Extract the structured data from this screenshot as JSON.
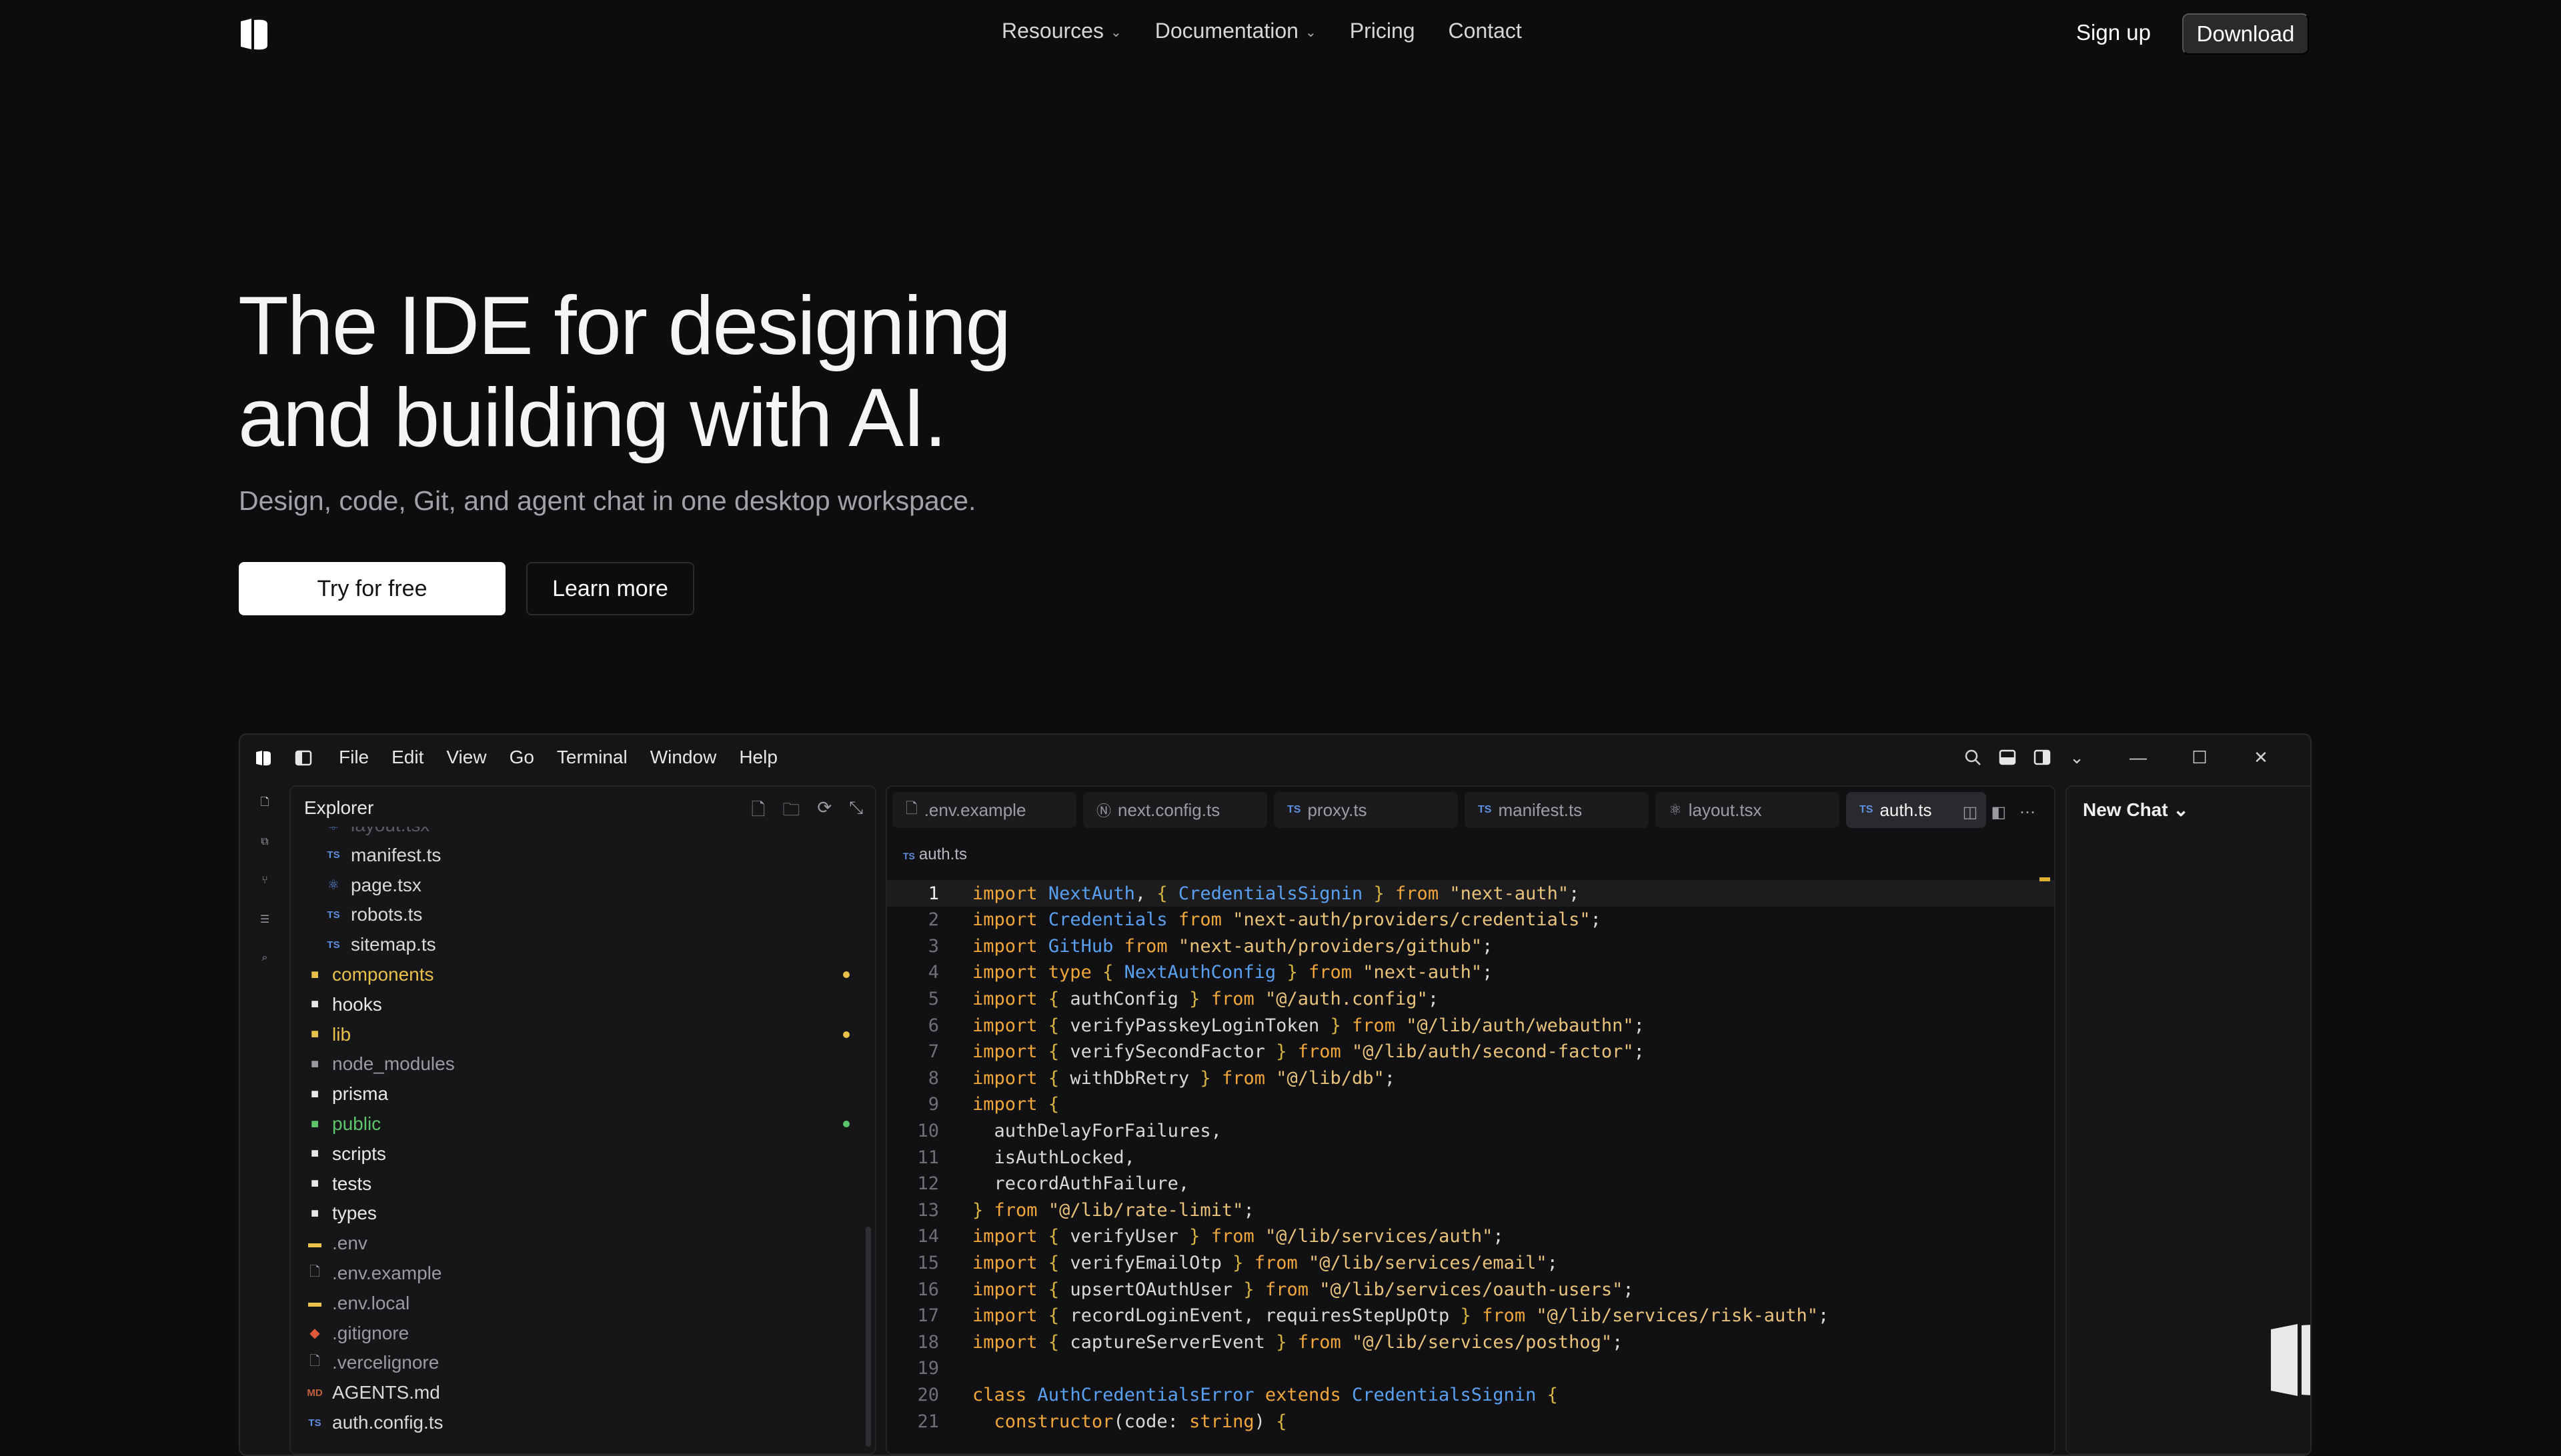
{
  "nav": {
    "items": [
      {
        "label": "Resources",
        "dropdown": true
      },
      {
        "label": "Documentation",
        "dropdown": true
      },
      {
        "label": "Pricing",
        "dropdown": false
      },
      {
        "label": "Contact",
        "dropdown": false
      }
    ],
    "signup": "Sign up",
    "download": "Download"
  },
  "hero": {
    "title_line1": "The IDE for designing",
    "title_line2": "and building with AI.",
    "subtitle": "Design, code, Git, and agent chat in one desktop workspace.",
    "primary_cta": "Try for free",
    "secondary_cta": "Learn more"
  },
  "ide": {
    "menu": [
      "File",
      "Edit",
      "View",
      "Go",
      "Terminal",
      "Window",
      "Help"
    ],
    "explorer": {
      "title": "Explorer",
      "items": [
        {
          "name": "layout.tsx",
          "icon": "react-icon",
          "color": "#5a5a60",
          "indent": 1
        },
        {
          "name": "manifest.ts",
          "icon": "ts-icon",
          "color": "#d9d9d9",
          "indent": 1
        },
        {
          "name": "page.tsx",
          "icon": "react-icon",
          "color": "#d9d9d9",
          "indent": 1
        },
        {
          "name": "robots.ts",
          "icon": "ts-icon",
          "color": "#d9d9d9",
          "indent": 1
        },
        {
          "name": "sitemap.ts",
          "icon": "ts-icon",
          "color": "#d9d9d9",
          "indent": 1
        },
        {
          "name": "components",
          "icon": "folder-icon",
          "color": "#e8c04a",
          "indent": 0,
          "dot": "#e8c04a"
        },
        {
          "name": "hooks",
          "icon": "folder-icon",
          "color": "#e8e8e8",
          "indent": 0
        },
        {
          "name": "lib",
          "icon": "folder-icon",
          "color": "#e8c04a",
          "indent": 0,
          "dot": "#e8c04a"
        },
        {
          "name": "node_modules",
          "icon": "folder-icon",
          "color": "#9a9aa0",
          "indent": 0
        },
        {
          "name": "prisma",
          "icon": "folder-icon",
          "color": "#e8e8e8",
          "indent": 0
        },
        {
          "name": "public",
          "icon": "folder-icon",
          "color": "#5cc46a",
          "indent": 0,
          "dot": "#5cc46a"
        },
        {
          "name": "scripts",
          "icon": "folder-icon",
          "color": "#e8e8e8",
          "indent": 0
        },
        {
          "name": "tests",
          "icon": "folder-icon",
          "color": "#e8e8e8",
          "indent": 0
        },
        {
          "name": "types",
          "icon": "folder-icon",
          "color": "#e8e8e8",
          "indent": 0
        },
        {
          "name": ".env",
          "icon": "env-icon",
          "color": "#9a9aa0",
          "indent": 0
        },
        {
          "name": ".env.example",
          "icon": "file-icon",
          "color": "#9a9aa0",
          "indent": 0
        },
        {
          "name": ".env.local",
          "icon": "env-icon",
          "color": "#9a9aa0",
          "indent": 0
        },
        {
          "name": ".gitignore",
          "icon": "git-icon",
          "color": "#9a9aa0",
          "indent": 0
        },
        {
          "name": ".vercelignore",
          "icon": "file-icon",
          "color": "#9a9aa0",
          "indent": 0
        },
        {
          "name": "AGENTS.md",
          "icon": "md-icon",
          "color": "#d9d9d9",
          "indent": 0
        },
        {
          "name": "auth.config.ts",
          "icon": "ts-icon",
          "color": "#d9d9d9",
          "indent": 0
        }
      ]
    },
    "tabs": [
      {
        "label": ".env.example",
        "icon": "file-icon",
        "active": false
      },
      {
        "label": "next.config.ts",
        "icon": "next-icon",
        "active": false
      },
      {
        "label": "proxy.ts",
        "icon": "ts-icon",
        "active": false
      },
      {
        "label": "manifest.ts",
        "icon": "ts-icon",
        "active": false
      },
      {
        "label": "layout.tsx",
        "icon": "react-icon",
        "active": false
      },
      {
        "label": "auth.ts",
        "icon": "ts-icon",
        "active": true
      }
    ],
    "breadcrumb": "auth.ts",
    "code_lines": [
      "<span class=\"kw\">import</span> <span class=\"ty\">NextAuth</span>, <span class=\"bk\">{</span> <span class=\"ty\">CredentialsSignin</span> <span class=\"bk\">}</span> <span class=\"kw\">from</span> <span class=\"st\">\"next-auth\"</span>;",
      "<span class=\"kw\">import</span> <span class=\"ty\">Credentials</span> <span class=\"kw\">from</span> <span class=\"st\">\"next-auth/providers/credentials\"</span>;",
      "<span class=\"kw\">import</span> <span class=\"ty\">GitHub</span> <span class=\"kw\">from</span> <span class=\"st\">\"next-auth/providers/github\"</span>;",
      "<span class=\"kw\">import type</span> <span class=\"bk\">{</span> <span class=\"ty\">NextAuthConfig</span> <span class=\"bk\">}</span> <span class=\"kw\">from</span> <span class=\"st\">\"next-auth\"</span>;",
      "<span class=\"kw\">import</span> <span class=\"bk\">{</span> authConfig <span class=\"bk\">}</span> <span class=\"kw\">from</span> <span class=\"st\">\"@/auth.config\"</span>;",
      "<span class=\"kw\">import</span> <span class=\"bk\">{</span> verifyPasskeyLoginToken <span class=\"bk\">}</span> <span class=\"kw\">from</span> <span class=\"st\">\"@/lib/auth/webauthn\"</span>;",
      "<span class=\"kw\">import</span> <span class=\"bk\">{</span> verifySecondFactor <span class=\"bk\">}</span> <span class=\"kw\">from</span> <span class=\"st\">\"@/lib/auth/second-factor\"</span>;",
      "<span class=\"kw\">import</span> <span class=\"bk\">{</span> withDbRetry <span class=\"bk\">}</span> <span class=\"kw\">from</span> <span class=\"st\">\"@/lib/db\"</span>;",
      "<span class=\"kw\">import</span> <span class=\"bk\">{</span>",
      "  authDelayForFailures,",
      "  isAuthLocked,",
      "  recordAuthFailure,",
      "<span class=\"bk\">}</span> <span class=\"kw\">from</span> <span class=\"st\">\"@/lib/rate-limit\"</span>;",
      "<span class=\"kw\">import</span> <span class=\"bk\">{</span> verifyUser <span class=\"bk\">}</span> <span class=\"kw\">from</span> <span class=\"st\">\"@/lib/services/auth\"</span>;",
      "<span class=\"kw\">import</span> <span class=\"bk\">{</span> verifyEmailOtp <span class=\"bk\">}</span> <span class=\"kw\">from</span> <span class=\"st\">\"@/lib/services/email\"</span>;",
      "<span class=\"kw\">import</span> <span class=\"bk\">{</span> upsertOAuthUser <span class=\"bk\">}</span> <span class=\"kw\">from</span> <span class=\"st\">\"@/lib/services/oauth-users\"</span>;",
      "<span class=\"kw\">import</span> <span class=\"bk\">{</span> recordLoginEvent, requiresStepUpOtp <span class=\"bk\">}</span> <span class=\"kw\">from</span> <span class=\"st\">\"@/lib/services/risk-auth\"</span>;",
      "<span class=\"kw\">import</span> <span class=\"bk\">{</span> captureServerEvent <span class=\"bk\">}</span> <span class=\"kw\">from</span> <span class=\"st\">\"@/lib/services/posthog\"</span>;",
      "",
      "<span class=\"kw\">class</span> <span class=\"ty\">AuthCredentialsError</span> <span class=\"kw\">extends</span> <span class=\"ty\">CredentialsSignin</span> <span class=\"bk\">{</span>",
      "  <span class=\"kw\">constructor</span>(code: <span class=\"kw\">string</span>) <span class=\"bk\">{</span>"
    ],
    "chat": {
      "title": "New Chat"
    }
  }
}
